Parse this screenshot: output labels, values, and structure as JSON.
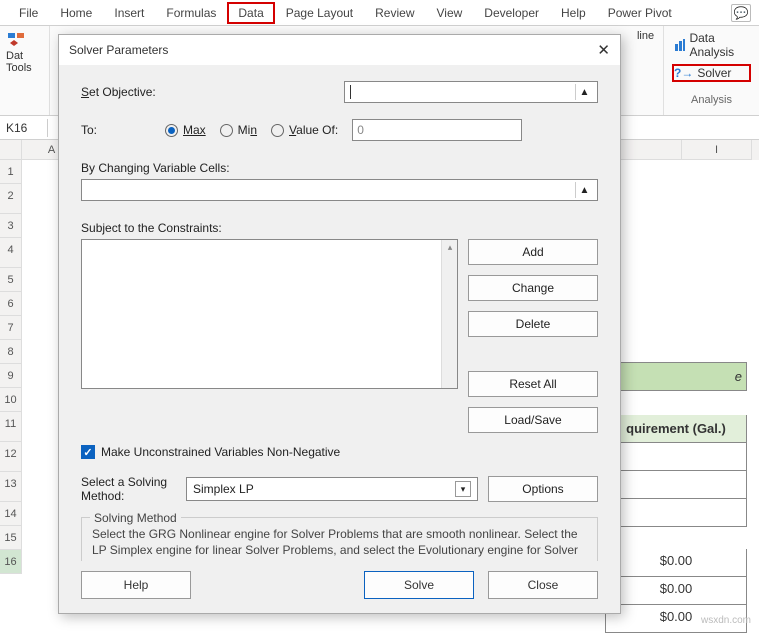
{
  "ribbon": {
    "tabs": [
      "File",
      "Home",
      "Insert",
      "Formulas",
      "Data",
      "Page Layout",
      "Review",
      "View",
      "Developer",
      "Help",
      "Power Pivot"
    ],
    "active_tab": "Data",
    "left_group_line1": "Dat",
    "left_group_line2": "Tools",
    "mid_group": "line",
    "analysis": {
      "data_analysis": "Data Analysis",
      "solver": "Solver",
      "group_label": "Analysis"
    }
  },
  "namebox": "K16",
  "columns": [
    "A",
    "I"
  ],
  "rows": [
    "1",
    "2",
    "3",
    "4",
    "5",
    "6",
    "7",
    "8",
    "9",
    "10",
    "11",
    "12",
    "13",
    "14",
    "15",
    "16"
  ],
  "right_table": {
    "header_suffix": "e",
    "col_header": "quirement (Gal.)",
    "vals": [
      "",
      "",
      "",
      "$0.00",
      "$0.00",
      "$0.00"
    ]
  },
  "dialog": {
    "title": "Solver Parameters",
    "set_objective": "Set Objective:",
    "objective_value": "",
    "to": "To:",
    "max": "Max",
    "min": "Min",
    "value_of": "Value Of:",
    "value_of_val": "0",
    "changing": "By Changing Variable Cells:",
    "subject": "Subject to the Constraints:",
    "add": "Add",
    "change": "Change",
    "delete": "Delete",
    "reset": "Reset All",
    "loadsave": "Load/Save",
    "unconstrained": "Make Unconstrained Variables Non-Negative",
    "select_method": "Select a Solving Method:",
    "method": "Simplex LP",
    "options": "Options",
    "info_title": "Solving Method",
    "info_text": "Select the GRG Nonlinear engine for Solver Problems that are smooth nonlinear. Select the LP Simplex engine for linear Solver Problems, and select the Evolutionary engine for Solver problems that are non-smooth.",
    "help": "Help",
    "solve": "Solve",
    "close": "Close"
  },
  "watermark": "wsxdn.com"
}
